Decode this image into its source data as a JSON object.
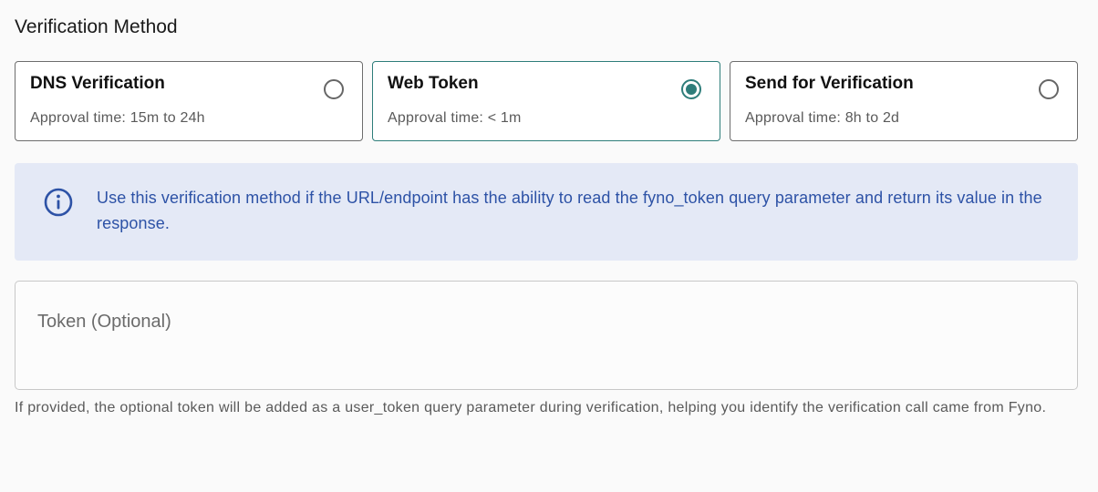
{
  "section": {
    "title": "Verification Method"
  },
  "options": [
    {
      "title": "DNS Verification",
      "subtitle": "Approval time: 15m to 24h",
      "selected": false
    },
    {
      "title": "Web Token",
      "subtitle": "Approval time: < 1m",
      "selected": true
    },
    {
      "title": "Send for Verification",
      "subtitle": "Approval time: 8h to 2d",
      "selected": false
    }
  ],
  "info": {
    "icon": "info-icon",
    "text": "Use this verification method if the URL/endpoint has the ability to read the fyno_token query parameter and return its value in the response."
  },
  "token": {
    "placeholder": "Token (Optional)",
    "value": "",
    "helper": "If provided, the optional token will be added as a user_token query parameter during verification, helping you identify the verification call came from Fyno."
  },
  "colors": {
    "accent": "#2e7d7a",
    "info_bg": "#e4e9f6",
    "info_text": "#2d52a6"
  }
}
